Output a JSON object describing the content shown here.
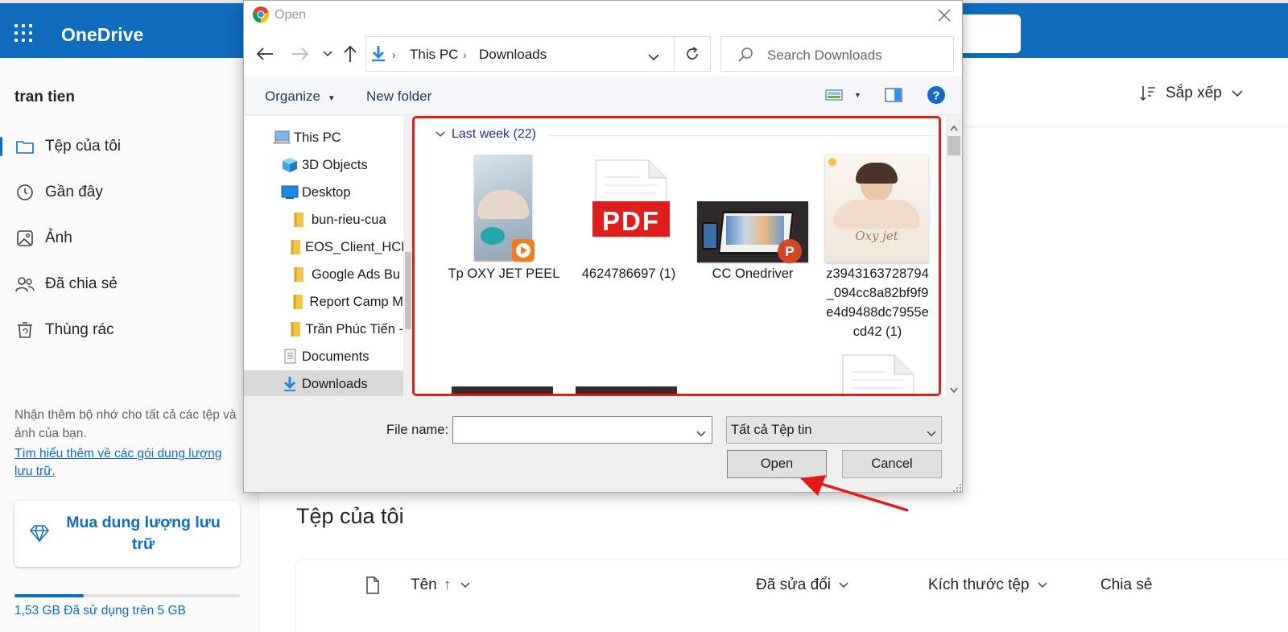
{
  "onedrive": {
    "brand": "OneDrive",
    "user_name": "tran tien",
    "nav": [
      {
        "label": "Tệp của tôi",
        "icon": "folder-icon"
      },
      {
        "label": "Gần đây",
        "icon": "history-icon"
      },
      {
        "label": "Ảnh",
        "icon": "image-icon"
      },
      {
        "label": "Đã chia sẻ",
        "icon": "people-icon"
      },
      {
        "label": "Thùng rác",
        "icon": "recycle-bin-icon"
      }
    ],
    "storage_note": "Nhận thêm bộ nhớ cho tất cả các tệp và ảnh của bạn.",
    "storage_link": "Tìm hiểu thêm về các gói dung lượng lưu trữ.",
    "buy_button": "Mua dung lượng lưu trữ",
    "quota_text": "1,53 GB Đã sử dụng trên 5 GB",
    "quota_fraction": 0.306,
    "sort_label": "Sắp xếp",
    "page_title": "Tệp của tôi",
    "columns": {
      "name": "Tên",
      "sort_indicator": "↑",
      "modified": "Đã sửa đổi",
      "size": "Kích thước tệp",
      "sharing": "Chia sẻ"
    },
    "accent": "#0f6cbd"
  },
  "dialog": {
    "title": "Open",
    "breadcrumb": [
      "This PC",
      "Downloads"
    ],
    "search_placeholder": "Search Downloads",
    "organize": "Organize",
    "new_folder": "New folder",
    "tree": [
      {
        "label": "This PC",
        "icon": "computer-icon",
        "indent": 0
      },
      {
        "label": "3D Objects",
        "icon": "cube-icon",
        "indent": 1
      },
      {
        "label": "Desktop",
        "icon": "desktop-icon",
        "indent": 1
      },
      {
        "label": "bun-rieu-cua",
        "icon": "folder-icon",
        "indent": 2
      },
      {
        "label": "EOS_Client_HCM",
        "icon": "folder-icon",
        "indent": 2
      },
      {
        "label": "Google Ads Bu",
        "icon": "folder-icon",
        "indent": 2
      },
      {
        "label": "Report Camp M",
        "icon": "folder-icon",
        "indent": 2
      },
      {
        "label": "Trần Phúc Tiến -",
        "icon": "folder-icon",
        "indent": 2
      },
      {
        "label": "Documents",
        "icon": "documents-icon",
        "indent": 1
      },
      {
        "label": "Downloads",
        "icon": "download-icon",
        "indent": 1
      }
    ],
    "group_header": "Last week (22)",
    "files": [
      {
        "label": "Tp OXY JET PEEL",
        "type": "video"
      },
      {
        "label": "4624786697 (1)",
        "type": "pdf"
      },
      {
        "label": "CC Onedriver",
        "type": "pptx"
      },
      {
        "label": "z3943163728794_094cc8a82bf9f9e4d9488dc7955ecd42 (1)",
        "label_lines": [
          "z3943163728794",
          "_094cc8a82bf9f9",
          "e4d9488dc7955e",
          "cd42 (1)"
        ],
        "type": "image"
      }
    ],
    "pdf_badge": "PDF",
    "oxy_badge": "Oxy jet",
    "file_name_label": "File name:",
    "file_name_value": "",
    "file_type": "Tất cả Tệp tin",
    "open_button": "Open",
    "cancel_button": "Cancel",
    "highlight_color": "#e21a1a"
  }
}
